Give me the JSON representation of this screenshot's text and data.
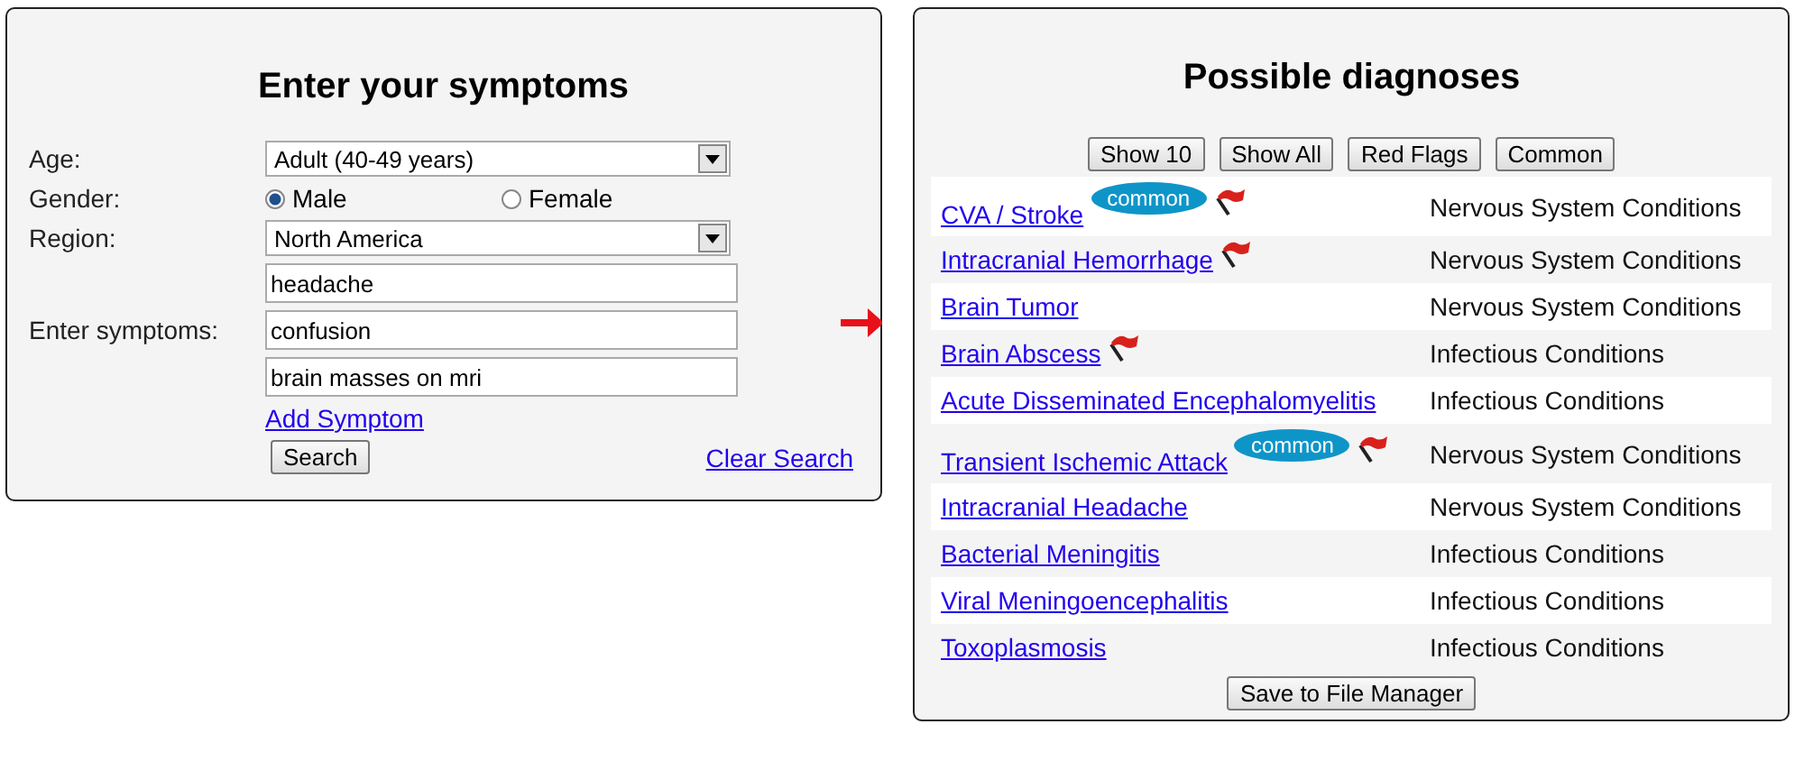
{
  "symptom_form": {
    "title": "Enter your symptoms",
    "age": {
      "label": "Age:",
      "value": "Adult (40-49 years)"
    },
    "gender": {
      "label": "Gender:",
      "options": [
        {
          "label": "Male",
          "selected": true
        },
        {
          "label": "Female",
          "selected": false
        }
      ]
    },
    "region": {
      "label": "Region:",
      "value": "North America"
    },
    "symptoms": {
      "label": "Enter symptoms:",
      "values": [
        "headache",
        "confusion",
        "brain masses on mri"
      ]
    },
    "add_link": "Add Symptom",
    "search_button": "Search",
    "clear_link": "Clear Search"
  },
  "diagnoses": {
    "title": "Possible diagnoses",
    "filter_buttons": [
      "Show 10",
      "Show All",
      "Red Flags",
      "Common"
    ],
    "rows": [
      {
        "name": "CVA / Stroke",
        "common_badge": "common",
        "red_flag": true,
        "category": "Nervous System Conditions"
      },
      {
        "name": "Intracranial Hemorrhage",
        "red_flag": true,
        "category": "Nervous System Conditions"
      },
      {
        "name": "Brain Tumor",
        "red_flag": false,
        "category": "Nervous System Conditions"
      },
      {
        "name": "Brain Abscess",
        "red_flag": true,
        "category": "Infectious Conditions"
      },
      {
        "name": "Acute Disseminated Encephalomyelitis",
        "red_flag": false,
        "category": "Infectious Conditions"
      },
      {
        "name": "Transient Ischemic Attack",
        "common_badge": "common",
        "red_flag": true,
        "category": "Nervous System Conditions"
      },
      {
        "name": "Intracranial Headache",
        "red_flag": false,
        "category": "Nervous System Conditions"
      },
      {
        "name": "Bacterial Meningitis",
        "red_flag": false,
        "category": "Infectious Conditions"
      },
      {
        "name": "Viral Meningoencephalitis",
        "red_flag": false,
        "category": "Infectious Conditions"
      },
      {
        "name": "Toxoplasmosis",
        "red_flag": false,
        "category": "Infectious Conditions"
      }
    ],
    "save_button": "Save to File Manager"
  }
}
